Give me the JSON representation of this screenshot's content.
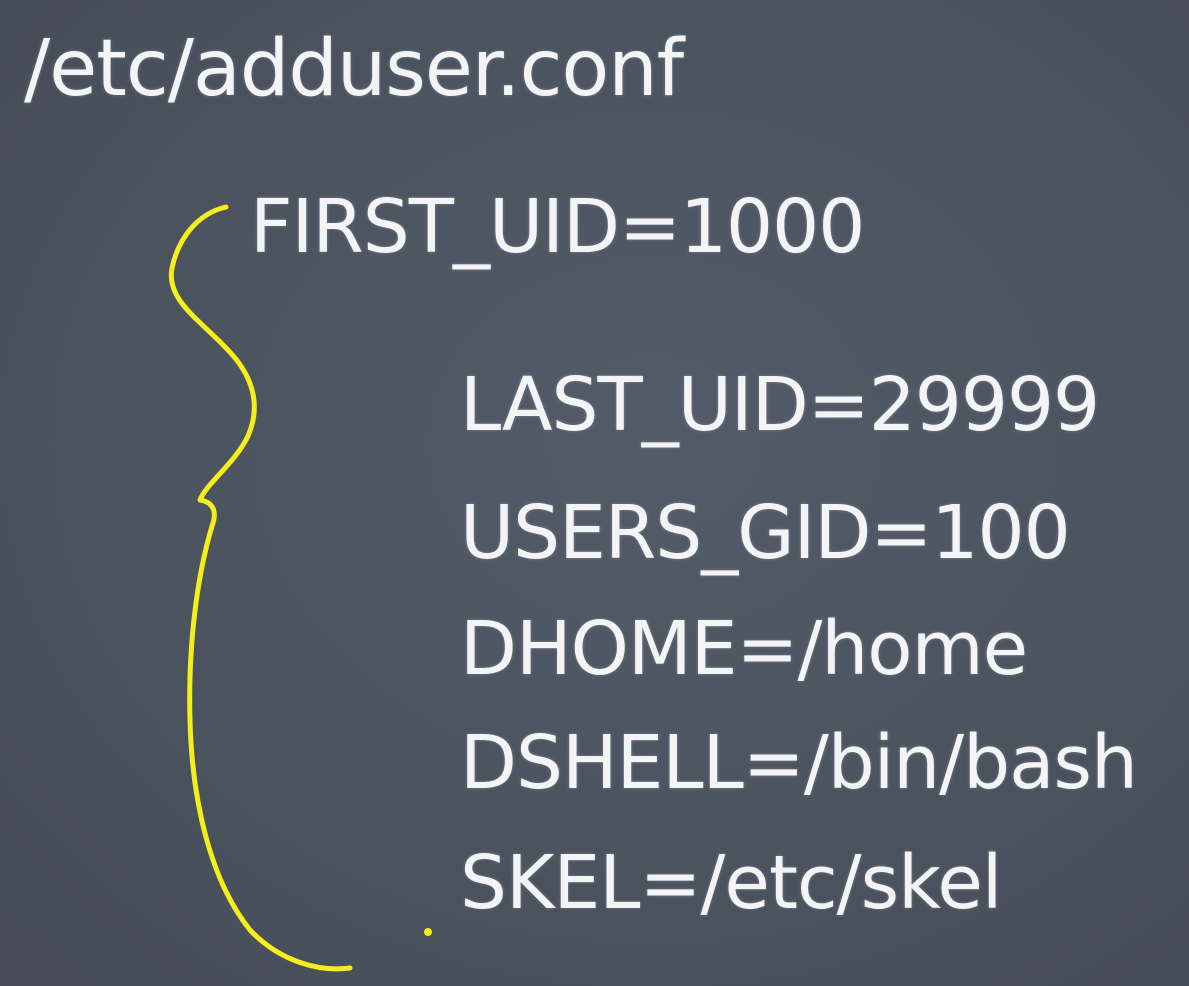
{
  "title": "/etc/adduser.conf",
  "first_entry": "FIRST_UID=1000",
  "entries": [
    "LAST_UID=29999",
    "USERS_GID=100",
    "DHOME=/home",
    "DSHELL=/bin/bash",
    "SKEL=/etc/skel"
  ],
  "colors": {
    "background": "#4a5260",
    "text": "#f2f4f6",
    "annotation": "#f4ee1c"
  }
}
